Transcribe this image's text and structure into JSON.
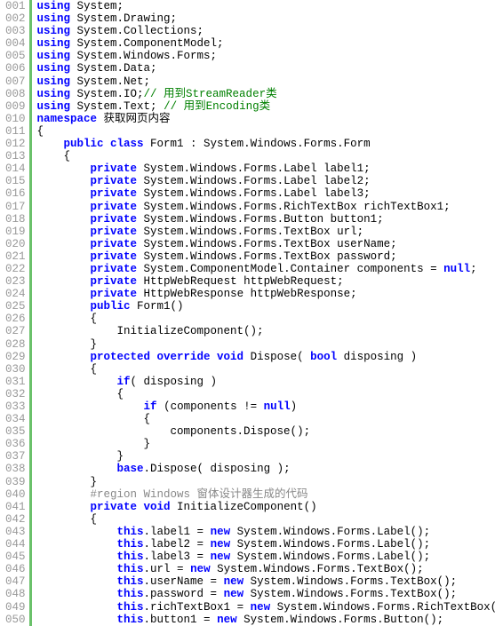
{
  "lines": [
    {
      "n": "001",
      "seg": [
        [
          "kw",
          "using"
        ],
        [
          "",
          " System;"
        ]
      ]
    },
    {
      "n": "002",
      "seg": [
        [
          "kw",
          "using"
        ],
        [
          "",
          " System.Drawing;"
        ]
      ]
    },
    {
      "n": "003",
      "seg": [
        [
          "kw",
          "using"
        ],
        [
          "",
          " System.Collections;"
        ]
      ]
    },
    {
      "n": "004",
      "seg": [
        [
          "kw",
          "using"
        ],
        [
          "",
          " System.ComponentModel;"
        ]
      ]
    },
    {
      "n": "005",
      "seg": [
        [
          "kw",
          "using"
        ],
        [
          "",
          " System.Windows.Forms;"
        ]
      ]
    },
    {
      "n": "006",
      "seg": [
        [
          "kw",
          "using"
        ],
        [
          "",
          " System.Data;"
        ]
      ]
    },
    {
      "n": "007",
      "seg": [
        [
          "kw",
          "using"
        ],
        [
          "",
          " System.Net;"
        ]
      ]
    },
    {
      "n": "008",
      "seg": [
        [
          "kw",
          "using"
        ],
        [
          "",
          " System.IO;"
        ],
        [
          "cm",
          "// 用到StreamReader类"
        ]
      ]
    },
    {
      "n": "009",
      "seg": [
        [
          "kw",
          "using"
        ],
        [
          "",
          " System.Text; "
        ],
        [
          "cm",
          "// 用到Encoding类"
        ]
      ]
    },
    {
      "n": "010",
      "seg": [
        [
          "kw",
          "namespace"
        ],
        [
          "",
          " 获取网页内容"
        ]
      ]
    },
    {
      "n": "011",
      "seg": [
        [
          "",
          "{"
        ]
      ]
    },
    {
      "n": "012",
      "seg": [
        [
          "",
          "    "
        ],
        [
          "kw",
          "public class"
        ],
        [
          "",
          " Form1 : System.Windows.Forms.Form"
        ]
      ]
    },
    {
      "n": "013",
      "seg": [
        [
          "",
          "    {"
        ]
      ]
    },
    {
      "n": "014",
      "seg": [
        [
          "",
          "        "
        ],
        [
          "kw",
          "private"
        ],
        [
          "",
          " System.Windows.Forms.Label label1;"
        ]
      ]
    },
    {
      "n": "015",
      "seg": [
        [
          "",
          "        "
        ],
        [
          "kw",
          "private"
        ],
        [
          "",
          " System.Windows.Forms.Label label2;"
        ]
      ]
    },
    {
      "n": "016",
      "seg": [
        [
          "",
          "        "
        ],
        [
          "kw",
          "private"
        ],
        [
          "",
          " System.Windows.Forms.Label label3;"
        ]
      ]
    },
    {
      "n": "017",
      "seg": [
        [
          "",
          "        "
        ],
        [
          "kw",
          "private"
        ],
        [
          "",
          " System.Windows.Forms.RichTextBox richTextBox1;"
        ]
      ]
    },
    {
      "n": "018",
      "seg": [
        [
          "",
          "        "
        ],
        [
          "kw",
          "private"
        ],
        [
          "",
          " System.Windows.Forms.Button button1;"
        ]
      ]
    },
    {
      "n": "019",
      "seg": [
        [
          "",
          "        "
        ],
        [
          "kw",
          "private"
        ],
        [
          "",
          " System.Windows.Forms.TextBox url;"
        ]
      ]
    },
    {
      "n": "020",
      "seg": [
        [
          "",
          "        "
        ],
        [
          "kw",
          "private"
        ],
        [
          "",
          " System.Windows.Forms.TextBox userName;"
        ]
      ]
    },
    {
      "n": "021",
      "seg": [
        [
          "",
          "        "
        ],
        [
          "kw",
          "private"
        ],
        [
          "",
          " System.Windows.Forms.TextBox password;"
        ]
      ]
    },
    {
      "n": "022",
      "seg": [
        [
          "",
          "        "
        ],
        [
          "kw",
          "private"
        ],
        [
          "",
          " System.ComponentModel.Container components = "
        ],
        [
          "kw",
          "null"
        ],
        [
          "",
          ";"
        ]
      ]
    },
    {
      "n": "023",
      "seg": [
        [
          "",
          "        "
        ],
        [
          "kw",
          "private"
        ],
        [
          "",
          " HttpWebRequest httpWebRequest;"
        ]
      ]
    },
    {
      "n": "024",
      "seg": [
        [
          "",
          "        "
        ],
        [
          "kw",
          "private"
        ],
        [
          "",
          " HttpWebResponse httpWebResponse;"
        ]
      ]
    },
    {
      "n": "025",
      "seg": [
        [
          "",
          "        "
        ],
        [
          "kw",
          "public"
        ],
        [
          "",
          " Form1()"
        ]
      ]
    },
    {
      "n": "026",
      "seg": [
        [
          "",
          "        {"
        ]
      ]
    },
    {
      "n": "027",
      "seg": [
        [
          "",
          "            InitializeComponent();"
        ]
      ]
    },
    {
      "n": "028",
      "seg": [
        [
          "",
          "        }"
        ]
      ]
    },
    {
      "n": "029",
      "seg": [
        [
          "",
          "        "
        ],
        [
          "kw",
          "protected override void"
        ],
        [
          "",
          " Dispose( "
        ],
        [
          "kw",
          "bool"
        ],
        [
          "",
          " disposing )"
        ]
      ]
    },
    {
      "n": "030",
      "seg": [
        [
          "",
          "        {"
        ]
      ]
    },
    {
      "n": "031",
      "seg": [
        [
          "",
          "            "
        ],
        [
          "kw",
          "if"
        ],
        [
          "",
          "( disposing )"
        ]
      ]
    },
    {
      "n": "032",
      "seg": [
        [
          "",
          "            {"
        ]
      ]
    },
    {
      "n": "033",
      "seg": [
        [
          "",
          "                "
        ],
        [
          "kw",
          "if"
        ],
        [
          "",
          " (components != "
        ],
        [
          "kw",
          "null"
        ],
        [
          "",
          ")"
        ]
      ]
    },
    {
      "n": "034",
      "seg": [
        [
          "",
          "                {"
        ]
      ]
    },
    {
      "n": "035",
      "seg": [
        [
          "",
          "                    components.Dispose();"
        ]
      ]
    },
    {
      "n": "036",
      "seg": [
        [
          "",
          "                }"
        ]
      ]
    },
    {
      "n": "037",
      "seg": [
        [
          "",
          "            }"
        ]
      ]
    },
    {
      "n": "038",
      "seg": [
        [
          "",
          "            "
        ],
        [
          "kw",
          "base"
        ],
        [
          "",
          ".Dispose( disposing );"
        ]
      ]
    },
    {
      "n": "039",
      "seg": [
        [
          "",
          "        }"
        ]
      ]
    },
    {
      "n": "040",
      "seg": [
        [
          "",
          "        "
        ],
        [
          "rg",
          "#region Windows 窗体设计器生成的代码"
        ]
      ]
    },
    {
      "n": "041",
      "seg": [
        [
          "",
          "        "
        ],
        [
          "kw",
          "private void"
        ],
        [
          "",
          " InitializeComponent()"
        ]
      ]
    },
    {
      "n": "042",
      "seg": [
        [
          "",
          "        {"
        ]
      ]
    },
    {
      "n": "043",
      "seg": [
        [
          "",
          "            "
        ],
        [
          "kw",
          "this"
        ],
        [
          "",
          ".label1 = "
        ],
        [
          "kw",
          "new"
        ],
        [
          "",
          " System.Windows.Forms.Label();"
        ]
      ]
    },
    {
      "n": "044",
      "seg": [
        [
          "",
          "            "
        ],
        [
          "kw",
          "this"
        ],
        [
          "",
          ".label2 = "
        ],
        [
          "kw",
          "new"
        ],
        [
          "",
          " System.Windows.Forms.Label();"
        ]
      ]
    },
    {
      "n": "045",
      "seg": [
        [
          "",
          "            "
        ],
        [
          "kw",
          "this"
        ],
        [
          "",
          ".label3 = "
        ],
        [
          "kw",
          "new"
        ],
        [
          "",
          " System.Windows.Forms.Label();"
        ]
      ]
    },
    {
      "n": "046",
      "seg": [
        [
          "",
          "            "
        ],
        [
          "kw",
          "this"
        ],
        [
          "",
          ".url = "
        ],
        [
          "kw",
          "new"
        ],
        [
          "",
          " System.Windows.Forms.TextBox();"
        ]
      ]
    },
    {
      "n": "047",
      "seg": [
        [
          "",
          "            "
        ],
        [
          "kw",
          "this"
        ],
        [
          "",
          ".userName = "
        ],
        [
          "kw",
          "new"
        ],
        [
          "",
          " System.Windows.Forms.TextBox();"
        ]
      ]
    },
    {
      "n": "048",
      "seg": [
        [
          "",
          "            "
        ],
        [
          "kw",
          "this"
        ],
        [
          "",
          ".password = "
        ],
        [
          "kw",
          "new"
        ],
        [
          "",
          " System.Windows.Forms.TextBox();"
        ]
      ]
    },
    {
      "n": "049",
      "seg": [
        [
          "",
          "            "
        ],
        [
          "kw",
          "this"
        ],
        [
          "",
          ".richTextBox1 = "
        ],
        [
          "kw",
          "new"
        ],
        [
          "",
          " System.Windows.Forms.RichTextBox();"
        ]
      ]
    },
    {
      "n": "050",
      "seg": [
        [
          "",
          "            "
        ],
        [
          "kw",
          "this"
        ],
        [
          "",
          ".button1 = "
        ],
        [
          "kw",
          "new"
        ],
        [
          "",
          " System.Windows.Forms.Button();"
        ]
      ]
    }
  ]
}
